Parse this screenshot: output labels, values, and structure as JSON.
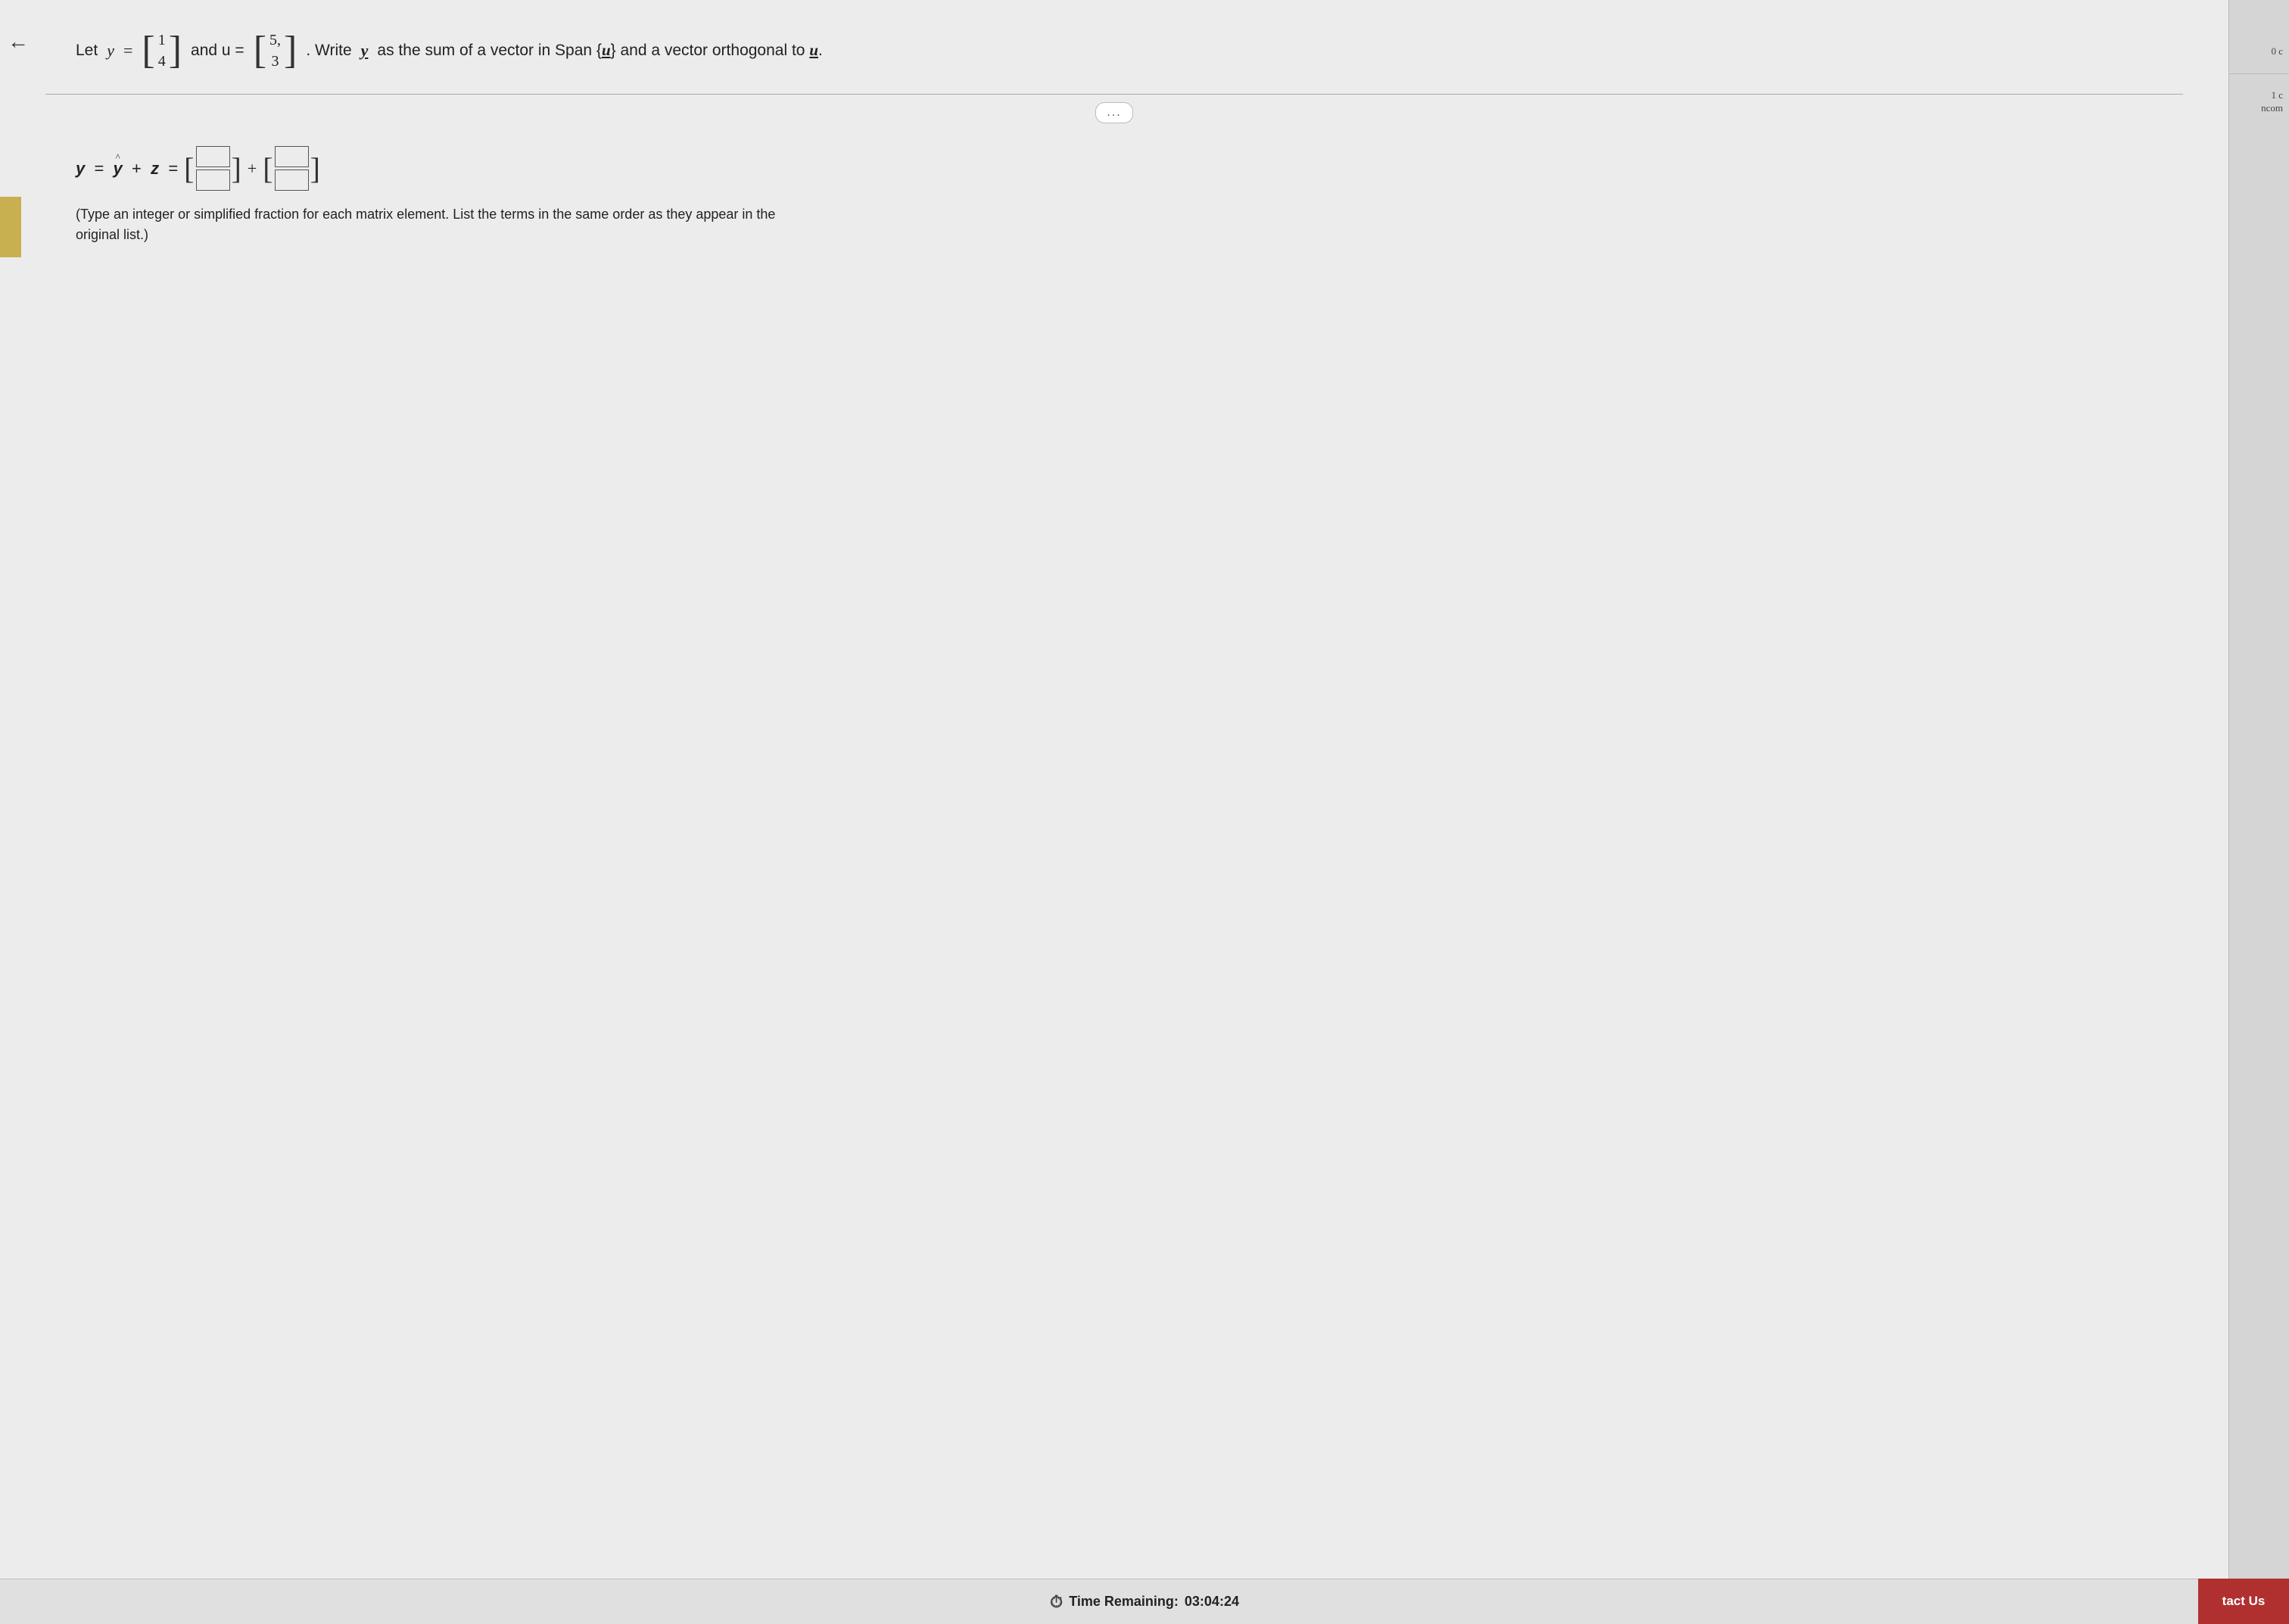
{
  "header": {
    "back_arrow": "←",
    "question": {
      "let_text": "Let",
      "y_var": "y",
      "equals": "=",
      "y_matrix": [
        "1",
        "4"
      ],
      "and_u_text": "and u =",
      "u_matrix": [
        "5,",
        "3"
      ],
      "instruction": ". Write",
      "y_bold": "y",
      "as_text": "as the sum of a vector in Span {",
      "u_bold": "u",
      "rest": "} and a vector orthogonal to",
      "u_bold2": "u",
      "period": "."
    }
  },
  "divider": {
    "ellipsis": "..."
  },
  "answer": {
    "equation_prefix": "y = ŷ + z =",
    "plus": "+",
    "hint": "(Type an integer or simplified fraction for each matrix element. List the terms in the same order as they appear in the\noriginal list.)"
  },
  "sidebar": {
    "item0": "0 c",
    "item1": "1 c",
    "item2": "ncom"
  },
  "bottom_bar": {
    "time_label": "Time Remaining:",
    "time_value": "03:04:24",
    "contact_btn": "tact Us"
  }
}
